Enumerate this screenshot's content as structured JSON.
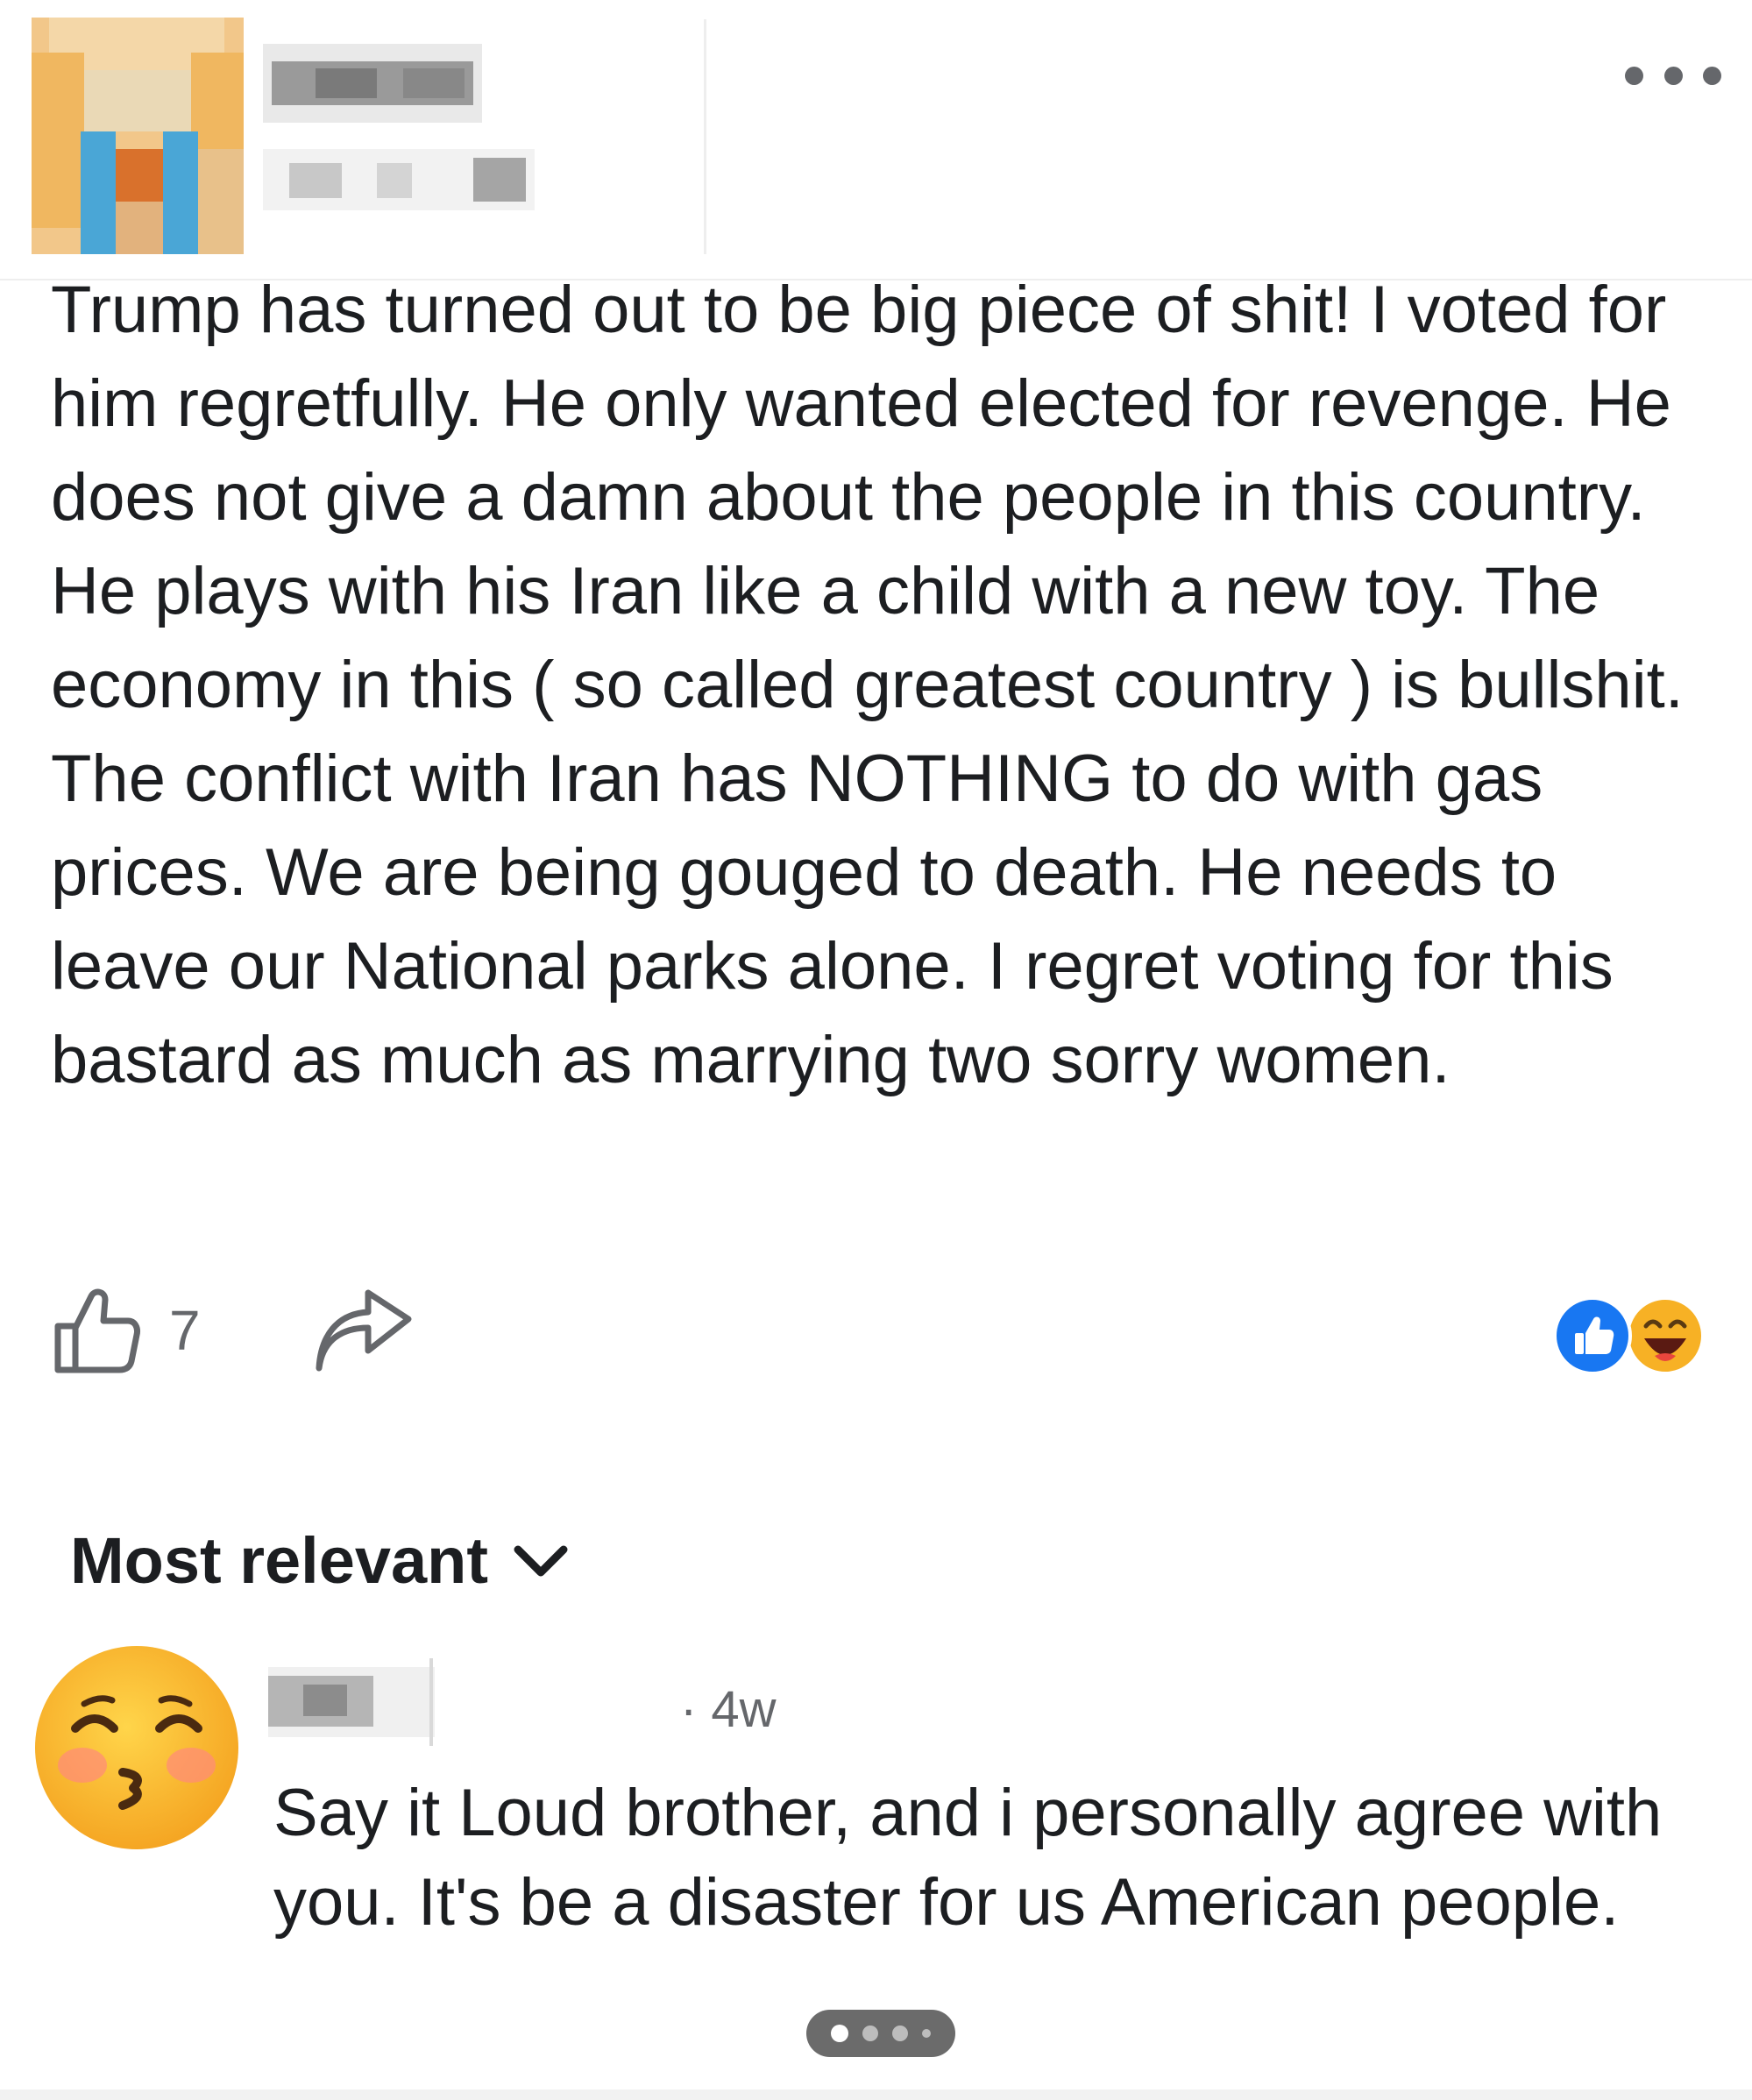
{
  "post": {
    "text": "Trump has turned out to be big piece of shit! I voted for him regretfully. He only wanted elected for revenge. He does not give a damn about the people in this country. He plays with his Iran like a child with a new toy. The economy in this ( so called greatest country ) is bullshit. The conflict with Iran has NOTHING to do with gas prices. We are being gouged to death. He needs to leave our National parks alone. I regret voting for this bastard as much as marrying two sorry women.",
    "like_count": "7",
    "icons": {
      "like": "thumbs-up-outline-icon",
      "share": "share-arrow-icon",
      "more": "more-options-icon",
      "reaction_like": "like-reaction-icon",
      "reaction_haha": "haha-reaction-icon"
    }
  },
  "comments_section": {
    "sort_label": "Most relevant",
    "sort_icon": "chevron-down-icon"
  },
  "comment": {
    "time": "· 4w",
    "text": "Say it Loud brother,  and i personally agree with you. It's be a disaster for us American people.",
    "avatar_icon": "kissing-blushing-face-icon"
  },
  "colors": {
    "text_primary": "#1c1e21",
    "text_secondary": "#65676b",
    "like_blue": "#1877f2",
    "haha_yellow": "#f7b125"
  }
}
